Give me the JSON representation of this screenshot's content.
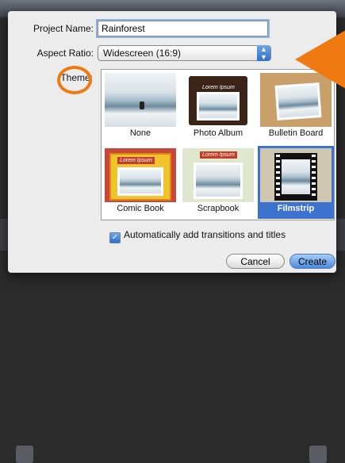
{
  "form": {
    "project_name_label": "Project Name:",
    "project_name_value": "Rainforest",
    "aspect_ratio_label": "Aspect Ratio:",
    "aspect_ratio_value": "Widescreen (16:9)",
    "theme_label": "Theme:"
  },
  "themes": [
    {
      "label": "None",
      "selected": false
    },
    {
      "label": "Photo Album",
      "selected": false
    },
    {
      "label": "Bulletin Board",
      "selected": false
    },
    {
      "label": "Comic Book",
      "selected": false
    },
    {
      "label": "Scrapbook",
      "selected": false
    },
    {
      "label": "Filmstrip",
      "selected": true
    }
  ],
  "thumb_text": "Lorem Ipsum",
  "options": {
    "auto_transitions_label": "Automatically add transitions and titles",
    "auto_transitions_checked": true
  },
  "buttons": {
    "cancel": "Cancel",
    "create": "Create"
  },
  "colors": {
    "annotation": "#f07a12",
    "selection": "#3d73cf"
  }
}
